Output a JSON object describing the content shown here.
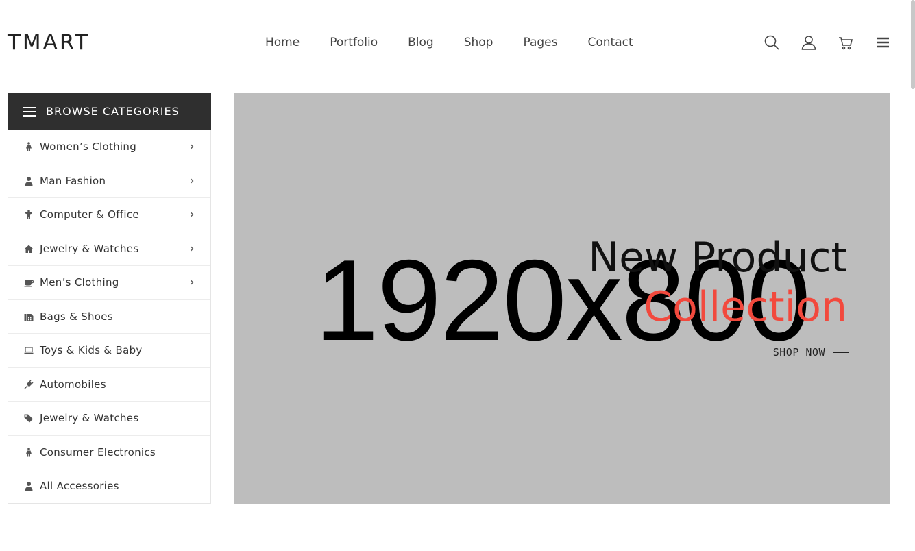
{
  "header": {
    "logo": "TMART",
    "nav": [
      "Home",
      "Portfolio",
      "Blog",
      "Shop",
      "Pages",
      "Contact"
    ],
    "icons": [
      "search-icon",
      "user-icon",
      "cart-icon",
      "menu-icon"
    ]
  },
  "sidebar": {
    "title": "BROWSE CATEGORIES",
    "items": [
      {
        "label": "Women’s Clothing",
        "icon": "female-icon",
        "has_submenu": true
      },
      {
        "label": "Man Fashion",
        "icon": "user-icon",
        "has_submenu": true
      },
      {
        "label": "Computer & Office",
        "icon": "child-icon",
        "has_submenu": true
      },
      {
        "label": "Jewelry & Watches",
        "icon": "home-icon",
        "has_submenu": true
      },
      {
        "label": "Men’s Clothing",
        "icon": "coffee-icon",
        "has_submenu": true
      },
      {
        "label": "Bags & Shoes",
        "icon": "fax-icon",
        "has_submenu": false
      },
      {
        "label": "Toys & Kids & Baby",
        "icon": "laptop-icon",
        "has_submenu": false
      },
      {
        "label": "Automobiles",
        "icon": "plug-icon",
        "has_submenu": false
      },
      {
        "label": "Jewelry & Watches",
        "icon": "tags-icon",
        "has_submenu": false
      },
      {
        "label": "Consumer Electronics",
        "icon": "female-icon",
        "has_submenu": false
      },
      {
        "label": "All Accessories",
        "icon": "user-icon",
        "has_submenu": false
      }
    ]
  },
  "hero": {
    "placeholder": "1920x800",
    "title": "New Product",
    "subtitle": "Collection",
    "cta": "SHOP NOW",
    "colors": {
      "background": "#bdbdbd",
      "accent": "#f2493d"
    }
  }
}
